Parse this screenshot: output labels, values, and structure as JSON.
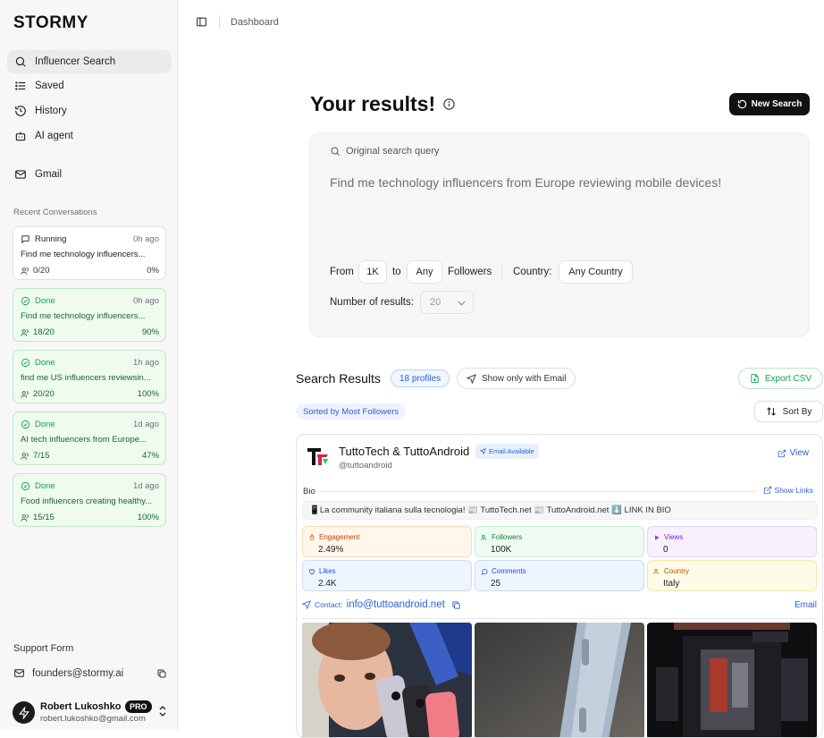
{
  "app": {
    "logo": "STORMY",
    "breadcrumb": "Dashboard"
  },
  "nav": [
    {
      "label": "Influencer Search",
      "icon": "search-icon",
      "active": true
    },
    {
      "label": "Saved",
      "icon": "list-icon"
    },
    {
      "label": "History",
      "icon": "history-icon"
    },
    {
      "label": "AI agent",
      "icon": "bot-icon"
    },
    {
      "label": "Gmail",
      "icon": "mail-icon"
    }
  ],
  "recent": {
    "label": "Recent Conversations",
    "items": [
      {
        "status": "Running",
        "time": "0h ago",
        "query": "Find me technology influencers...",
        "count": "0/20",
        "pct": "0%"
      },
      {
        "status": "Done",
        "time": "0h ago",
        "query": "Find me technology influencers...",
        "count": "18/20",
        "pct": "90%"
      },
      {
        "status": "Done",
        "time": "1h ago",
        "query": "find me US influencers reviewsin...",
        "count": "20/20",
        "pct": "100%"
      },
      {
        "status": "Done",
        "time": "1d ago",
        "query": "AI tech influencers from Europe...",
        "count": "7/15",
        "pct": "47%"
      },
      {
        "status": "Done",
        "time": "1d ago",
        "query": "Food influencers creating healthy...",
        "count": "15/15",
        "pct": "100%"
      }
    ]
  },
  "support": {
    "label": "Support Form",
    "email": "founders@stormy.ai"
  },
  "user": {
    "name": "Robert Lukoshko",
    "badge": "PRO",
    "email": "robert.lukoshko@gmail.com"
  },
  "results": {
    "title": "Your results!",
    "new_search": "New Search",
    "query_label": "Original search query",
    "query": "Find me technology influencers from Europe reviewing mobile devices!",
    "from_label": "From",
    "from_value": "1K",
    "to_label": "to",
    "to_value": "Any",
    "followers_label": "Followers",
    "country_label": "Country:",
    "country_value": "Any Country",
    "num_label": "Number of results:",
    "num_value": "20"
  },
  "search_results": {
    "title": "Search Results",
    "profiles_badge": "18 profiles",
    "email_filter": "Show only with Email",
    "export": "Export CSV",
    "sorted": "Sorted by Most Followers",
    "sort_by": "Sort By"
  },
  "card": {
    "name": "TuttoTech & TuttoAndroid",
    "email_badge": "Email Available",
    "handle": "@tuttoandroid",
    "view": "View",
    "bio_label": "Bio",
    "show_links": "Show Links",
    "bio": "📱La community italiana sulla tecnologia! 📰 TuttoTech.net 📰 TuttoAndroid.net ⬇️ LINK IN BIO",
    "stats": {
      "engagement": {
        "label": "Engagement",
        "value": "2.49%"
      },
      "followers": {
        "label": "Followers",
        "value": "100K"
      },
      "views": {
        "label": "Views",
        "value": "0"
      },
      "likes": {
        "label": "Likes",
        "value": "2.4K"
      },
      "comments": {
        "label": "Comments",
        "value": "25"
      },
      "country": {
        "label": "Country",
        "value": "Italy"
      }
    },
    "contact_label": "Contact:",
    "contact_email": "info@tuttoandroid.net",
    "email_link": "Email"
  },
  "colors": {
    "accent": "#f97316",
    "link": "#2b5fd0",
    "done_green": "#16a34a"
  }
}
